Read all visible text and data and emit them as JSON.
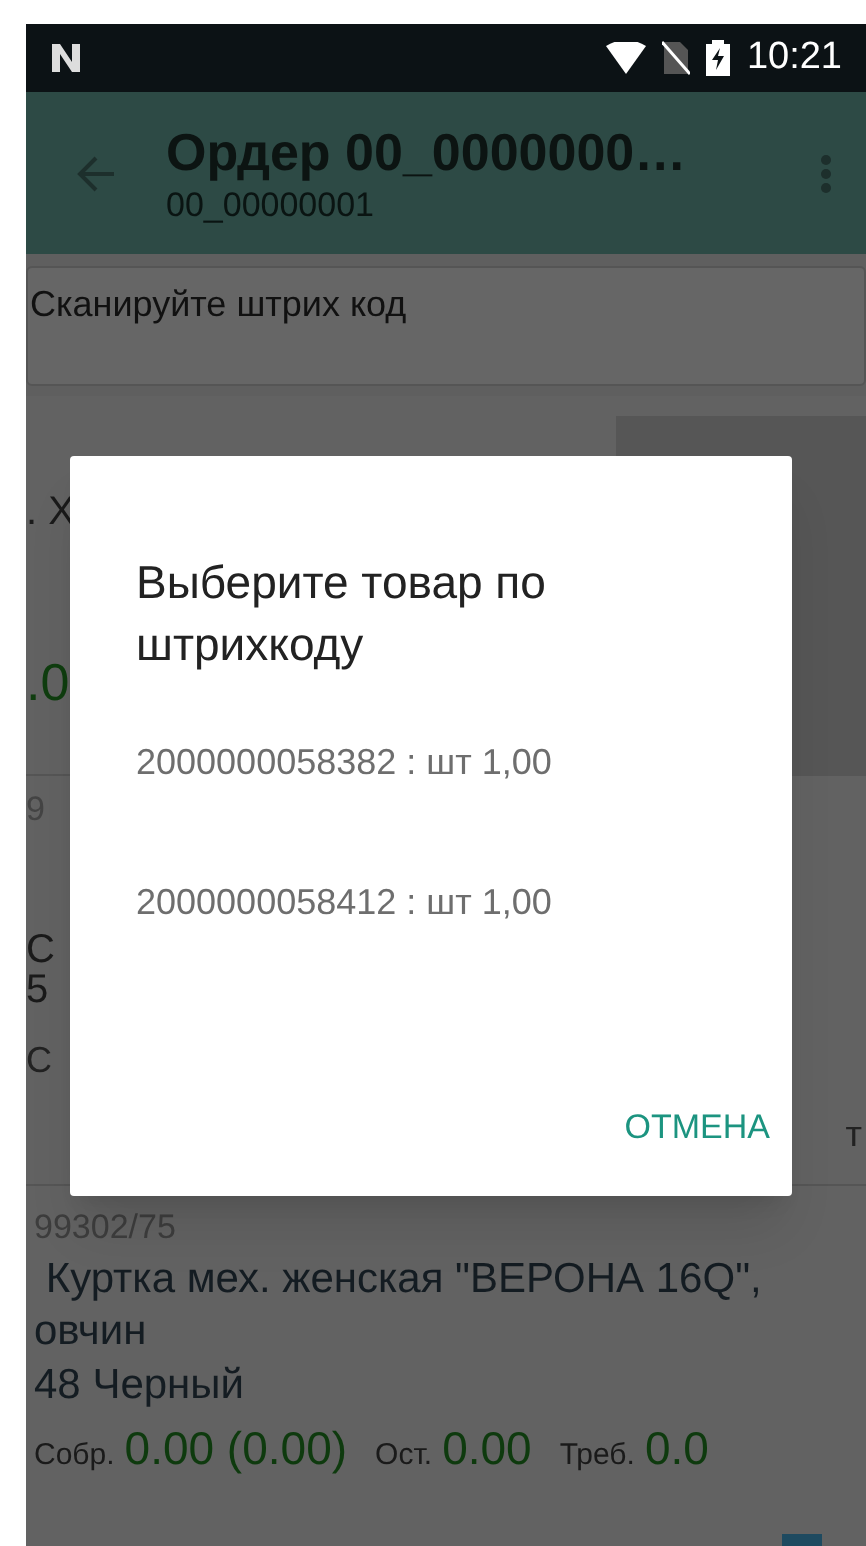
{
  "status_bar": {
    "time": "10:21"
  },
  "app_bar": {
    "title": "Ордер 00_0000000…",
    "subtitle": "00_00000001"
  },
  "scan_field": {
    "placeholder": "Сканируйте штрих код"
  },
  "covered_cards": [
    {
      "fragments": [
        {
          "text": ". Х",
          "kind": "plain"
        },
        {
          "text": ".0",
          "kind": "value"
        }
      ]
    },
    {
      "fragments": [
        {
          "text": "9",
          "kind": "code"
        },
        {
          "text": "С",
          "kind": "plain"
        },
        {
          "text": "5",
          "kind": "plain"
        },
        {
          "text": "С",
          "kind": "small"
        }
      ],
      "right_fragment": "т"
    }
  ],
  "item": {
    "code": "99302/75",
    "name": " Куртка мех. женская \"ВЕРОНА 16Q\", овчин",
    "size": "48 Черный",
    "stats": [
      {
        "label": "Собр.",
        "value": "0.00 (0.00)"
      },
      {
        "label": "Ост.",
        "value": "0.00"
      },
      {
        "label": "Треб.",
        "value": "0.0"
      }
    ]
  },
  "dialog": {
    "title": "Выберите товар по штрихкоду",
    "options": [
      {
        "text": "2000000058382 : шт 1,00"
      },
      {
        "text": "2000000058412 : шт 1,00"
      }
    ],
    "cancel": "ОТМЕНА"
  }
}
